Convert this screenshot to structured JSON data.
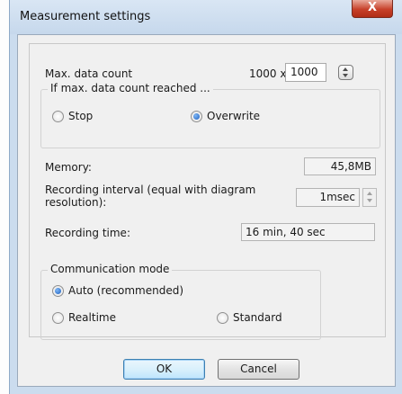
{
  "window": {
    "title": "Measurement settings",
    "close_label": "X"
  },
  "max_data_count": {
    "label": "Max. data count",
    "multiplier": "1000 x",
    "value": "1000"
  },
  "overflow_group": {
    "title": "If max. data count reached ...",
    "options": [
      {
        "label": "Stop",
        "checked": false
      },
      {
        "label": "Overwrite",
        "checked": true
      }
    ]
  },
  "memory": {
    "label": "Memory:",
    "value": "45,8MB"
  },
  "recording_interval": {
    "label_line1": "Recording interval (equal with diagram",
    "label_line2": "resolution):",
    "value": "1msec"
  },
  "recording_time": {
    "label": "Recording time:",
    "value": "16 min, 40 sec"
  },
  "communication_group": {
    "title": "Communication mode",
    "options": [
      {
        "label": "Auto (recommended)",
        "checked": true
      },
      {
        "label": "Realtime",
        "checked": false
      },
      {
        "label": "Standard",
        "checked": false
      }
    ]
  },
  "buttons": {
    "ok": "OK",
    "cancel": "Cancel"
  }
}
